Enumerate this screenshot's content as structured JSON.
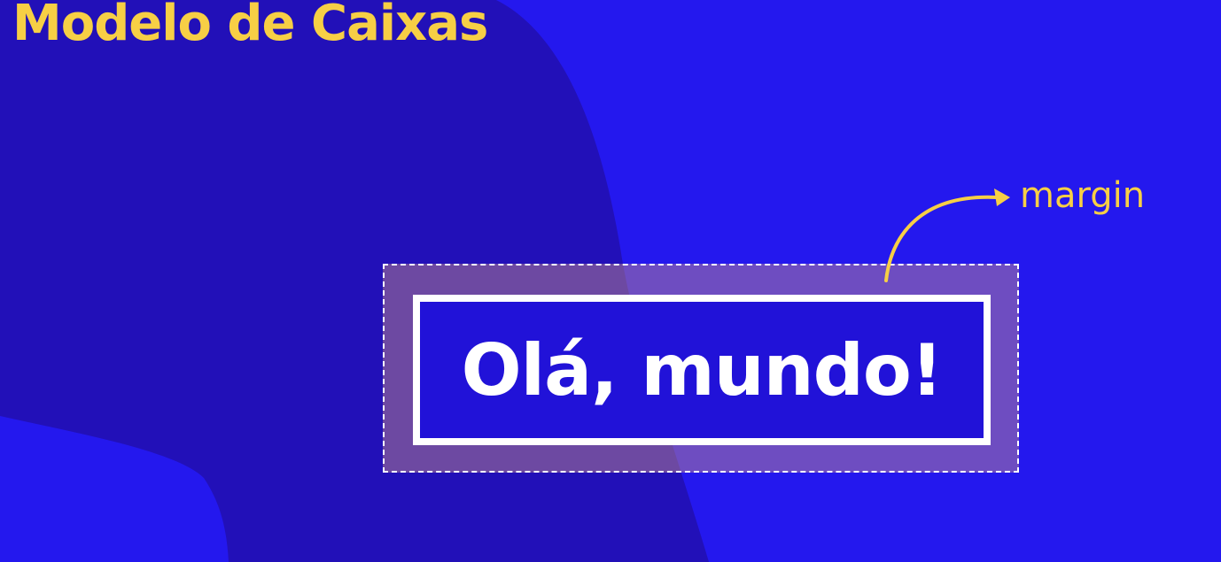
{
  "title": "Modelo de Caixas",
  "box": {
    "text": "Olá, mundo!"
  },
  "annotation": {
    "label": "margin"
  },
  "colors": {
    "background": "#2418ee",
    "shadow_shape": "#2210b8",
    "accent": "#f7cf45",
    "margin_area": "#d69984",
    "text": "#ffffff"
  }
}
